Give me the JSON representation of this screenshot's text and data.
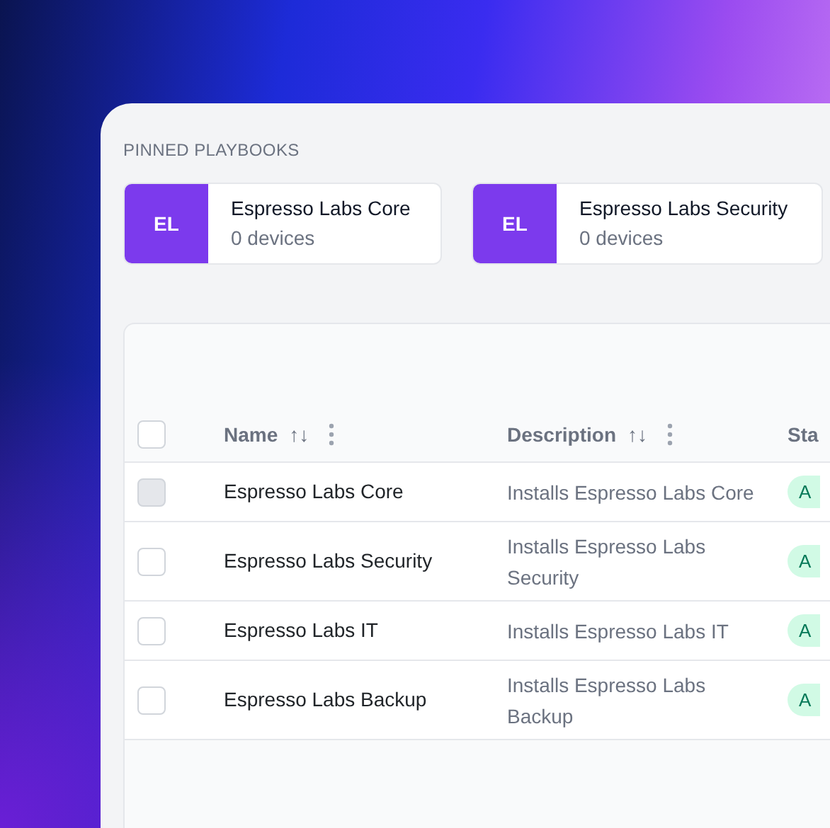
{
  "pinned": {
    "heading": "PINNED PLAYBOOKS",
    "items": [
      {
        "initials": "EL",
        "name": "Espresso Labs Core",
        "devices": "0 devices"
      },
      {
        "initials": "EL",
        "name": "Espresso Labs Security",
        "devices": "0 devices"
      }
    ]
  },
  "table": {
    "select_all": {
      "checked": false
    },
    "columns": [
      {
        "label": "Name",
        "sort_icon": "↑↓"
      },
      {
        "label": "Description",
        "sort_icon": "↑↓"
      },
      {
        "label": "Sta"
      }
    ],
    "rows": [
      {
        "checked": false,
        "disabled": true,
        "name": "Espresso Labs Core",
        "description": "Installs Espresso Labs Core",
        "status": "A"
      },
      {
        "checked": false,
        "disabled": false,
        "name": "Espresso Labs Security",
        "description": "Installs Espresso Labs Security",
        "status": "A"
      },
      {
        "checked": false,
        "disabled": false,
        "name": "Espresso Labs IT",
        "description": "Installs Espresso Labs IT",
        "status": "A"
      },
      {
        "checked": false,
        "disabled": false,
        "name": "Espresso Labs Backup",
        "description": "Installs Espresso Labs Backup",
        "status": "A"
      }
    ]
  }
}
